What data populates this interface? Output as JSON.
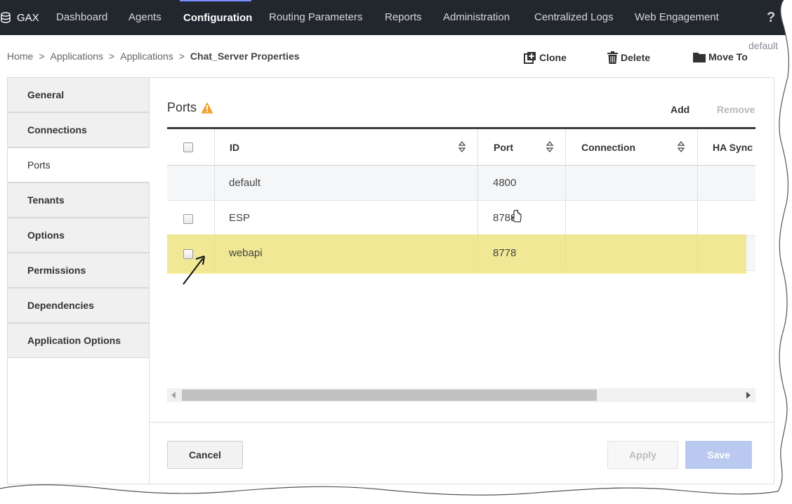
{
  "topnav": {
    "brand": "GAX",
    "items": [
      {
        "label": "Dashboard"
      },
      {
        "label": "Agents"
      },
      {
        "label": "Configuration",
        "active": true
      },
      {
        "label": "Routing Parameters"
      },
      {
        "label": "Reports"
      },
      {
        "label": "Administration"
      },
      {
        "label": "Centralized Logs"
      },
      {
        "label": "Web Engagement"
      }
    ],
    "help": "?"
  },
  "profile": "default",
  "breadcrumb": {
    "items": [
      "Home",
      "Applications",
      "Applications"
    ],
    "current": "Chat_Server Properties",
    "separator": ">"
  },
  "toolbar": {
    "clone": "Clone",
    "delete": "Delete",
    "move_to": "Move To"
  },
  "sidebar": {
    "items": [
      {
        "label": "General"
      },
      {
        "label": "Connections"
      },
      {
        "label": "Ports",
        "active": true
      },
      {
        "label": "Tenants"
      },
      {
        "label": "Options"
      },
      {
        "label": "Permissions"
      },
      {
        "label": "Dependencies"
      },
      {
        "label": "Application Options"
      }
    ]
  },
  "ports": {
    "title": "Ports",
    "warning_icon": "warning-icon",
    "add": "Add",
    "remove": "Remove",
    "columns": [
      "ID",
      "Port",
      "Connection",
      "HA Sync"
    ],
    "rows": [
      {
        "id": "default",
        "port": "4800",
        "connection": "",
        "ha_sync": ""
      },
      {
        "id": "ESP",
        "port": "8788",
        "connection": "",
        "ha_sync": ""
      },
      {
        "id": "webapi",
        "port": "8778",
        "connection": "",
        "ha_sync": "",
        "highlighted": true
      }
    ]
  },
  "footer": {
    "cancel": "Cancel",
    "apply": "Apply",
    "save": "Save"
  },
  "colors": {
    "nav_bg": "#22272e",
    "highlight": "#ece060",
    "save_bg": "#b9c9ef",
    "warning": "#f0a030"
  }
}
